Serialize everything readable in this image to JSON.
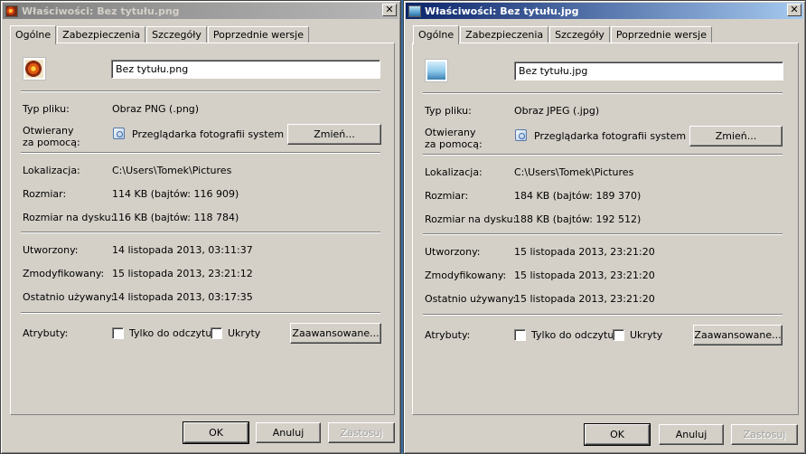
{
  "windows": [
    {
      "title": "Właściwości: Bez tytułu.png",
      "close_glyph": "✕",
      "tabs": [
        "Ogólne",
        "Zabezpieczenia",
        "Szczegóły",
        "Poprzednie wersje"
      ],
      "file_name": "Bez tytułu.png",
      "file_icon": "png-image-icon",
      "type_label": "Typ pliku:",
      "type_value": "Obraz PNG (.png)",
      "opens_with_label_1": "Otwierany",
      "opens_with_label_2": "za pomocą:",
      "opens_with_value": "Przeglądarka fotografii systemu Wi",
      "change_button": "Zmień...",
      "location_label": "Lokalizacja:",
      "location_value": "C:\\Users\\Tomek\\Pictures",
      "size_label": "Rozmiar:",
      "size_value": "114 KB (bajtów: 116 909)",
      "disk_size_label": "Rozmiar na dysku:",
      "disk_size_value": "116 KB (bajtów: 118 784)",
      "created_label": "Utworzony:",
      "created_value": "14 listopada 2013, 03:11:37",
      "modified_label": "Zmodyfikowany:",
      "modified_value": "15 listopada 2013, 23:21:12",
      "accessed_label": "Ostatnio używany:",
      "accessed_value": "14 listopada 2013, 03:17:35",
      "attributes_label": "Atrybuty:",
      "readonly_label": "Tylko do odczytu",
      "hidden_label": "Ukryty",
      "advanced_button": "Zaawansowane...",
      "ok_button": "OK",
      "cancel_button": "Anuluj",
      "apply_button": "Zastosuj"
    },
    {
      "title": "Właściwości: Bez tytułu.jpg",
      "close_glyph": "✕",
      "tabs": [
        "Ogólne",
        "Zabezpieczenia",
        "Szczegóły",
        "Poprzednie wersje"
      ],
      "file_name": "Bez tytułu.jpg",
      "file_icon": "jpeg-image-icon",
      "type_label": "Typ pliku:",
      "type_value": "Obraz JPEG (.jpg)",
      "opens_with_label_1": "Otwierany",
      "opens_with_label_2": "za pomocą:",
      "opens_with_value": "Przeglądarka fotografii systemu Wi",
      "change_button": "Zmień...",
      "location_label": "Lokalizacja:",
      "location_value": "C:\\Users\\Tomek\\Pictures",
      "size_label": "Rozmiar:",
      "size_value": "184 KB (bajtów: 189 370)",
      "disk_size_label": "Rozmiar na dysku:",
      "disk_size_value": "188 KB (bajtów: 192 512)",
      "created_label": "Utworzony:",
      "created_value": "15 listopada 2013, 23:21:20",
      "modified_label": "Zmodyfikowany:",
      "modified_value": "15 listopada 2013, 23:21:20",
      "accessed_label": "Ostatnio używany:",
      "accessed_value": "15 listopada 2013, 23:21:20",
      "attributes_label": "Atrybuty:",
      "readonly_label": "Tylko do odczytu",
      "hidden_label": "Ukryty",
      "advanced_button": "Zaawansowane...",
      "ok_button": "OK",
      "cancel_button": "Anuluj",
      "apply_button": "Zastosuj"
    }
  ],
  "colors": {
    "face": "#d4d0c8",
    "active_title": "#0a246a",
    "inactive_title": "#808080",
    "desktop": "#3a6ea5"
  }
}
